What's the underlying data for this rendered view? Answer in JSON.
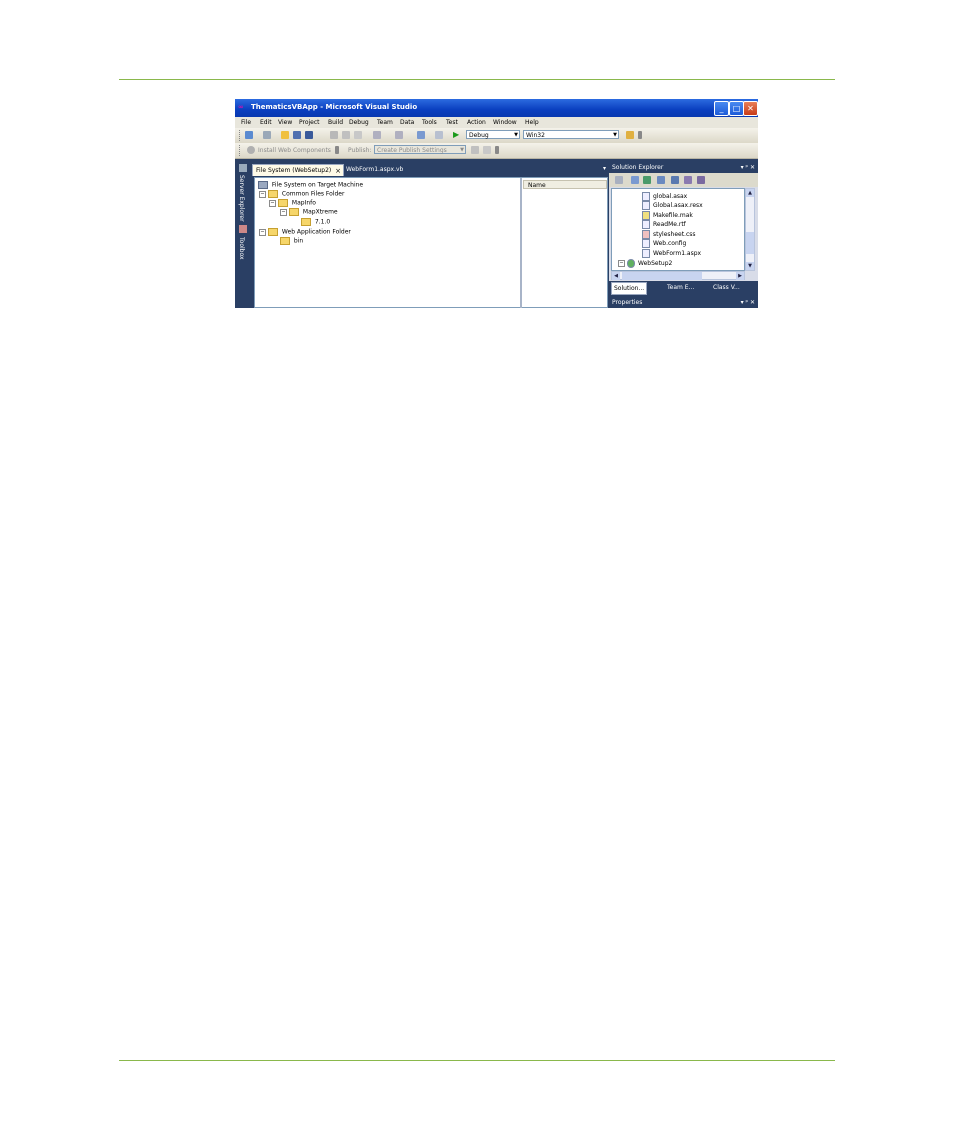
{
  "window": {
    "title": "ThematicsVBApp - Microsoft Visual Studio",
    "min_glyph": "_",
    "max_glyph": "□",
    "close_glyph": "✕"
  },
  "menu": [
    "File",
    "Edit",
    "View",
    "Project",
    "Build",
    "Debug",
    "Team",
    "Data",
    "Tools",
    "Test",
    "Action",
    "Window",
    "Help"
  ],
  "toolbar": {
    "config": "Debug",
    "platform": "Win32",
    "install_web_components": "Install Web Components",
    "publish": "Publish:",
    "publish_settings": "Create Publish Settings"
  },
  "side_tabs": {
    "server_explorer": "Server Explorer",
    "toolbox": "Toolbox"
  },
  "doc_tabs": {
    "active": "File System (WebSetup2)",
    "other": "WebForm1.aspx.vb"
  },
  "file_system_tree": {
    "root": "File System on Target Machine",
    "common": "Common Files Folder",
    "mapinfo": "MapInfo",
    "mapxtreme": "MapXtreme",
    "version": "7.1.0",
    "webapp": "Web Application Folder",
    "bin": "bin"
  },
  "name_column": "Name",
  "solution_explorer": {
    "title": "Solution Explorer",
    "items": [
      "global.asax",
      "Global.asax.resx",
      "Makefile.mak",
      "ReadMe.rtf",
      "stylesheet.css",
      "Web.config",
      "WebForm1.aspx"
    ],
    "project": "WebSetup2",
    "tabs": [
      "Solution...",
      "Team E...",
      "Class V..."
    ]
  },
  "panel_controls": "▾ ᵖ ✕",
  "properties": {
    "title": "Properties"
  }
}
